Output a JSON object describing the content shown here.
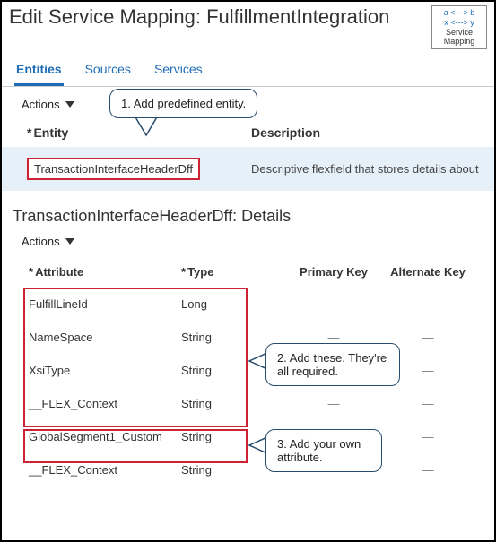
{
  "header": {
    "title": "Edit Service Mapping: FulfillmentIntegration"
  },
  "badge": {
    "line1": "a <---> b",
    "line2": "x <---> y",
    "caption": "Service Mapping"
  },
  "tabs": {
    "t0": "Entities",
    "t1": "Sources",
    "t2": "Services"
  },
  "actions_label": "Actions",
  "callout1": "1. Add predefined entity.",
  "callout2": "2. Add these. They're all required.",
  "callout3": "3. Add your own attribute.",
  "entity_table": {
    "col_entity": "Entity",
    "col_desc": "Description",
    "row": {
      "name": "TransactionInterfaceHeaderDff",
      "desc": "Descriptive flexfield that stores details about"
    }
  },
  "details_title": "TransactionInterfaceHeaderDff: Details",
  "attr_table": {
    "col_attr": "Attribute",
    "col_type": "Type",
    "col_pk": "Primary Key",
    "col_ak": "Alternate Key",
    "rows": [
      {
        "attr": "FulfillLineId",
        "type": "Long",
        "pk": "—",
        "ak": "—"
      },
      {
        "attr": "NameSpace",
        "type": "String",
        "pk": "—",
        "ak": "—"
      },
      {
        "attr": "XsiType",
        "type": "String",
        "pk": "—",
        "ak": "—"
      },
      {
        "attr": "__FLEX_Context",
        "type": "String",
        "pk": "—",
        "ak": "—"
      },
      {
        "attr": "GlobalSegment1_Custom",
        "type": "String",
        "pk": "—",
        "ak": "—"
      },
      {
        "attr": "__FLEX_Context",
        "type": "String",
        "pk": "—",
        "ak": "—"
      }
    ]
  },
  "colors": {
    "link": "#1e6db6",
    "highlight_row": "#e6f0f9",
    "red_box": "#c23",
    "callout_border": "#2a4d6e"
  }
}
